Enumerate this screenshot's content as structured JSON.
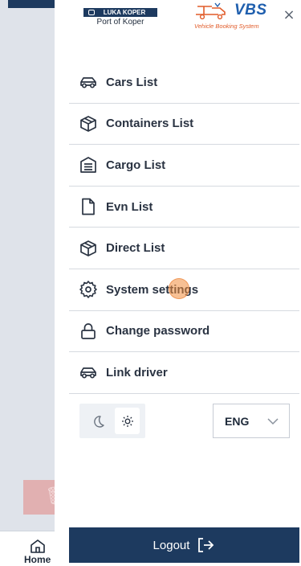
{
  "background": {
    "home_label": "Home"
  },
  "brand": {
    "port_badge": "LUKA KOPER",
    "port_sub": "Port of Koper",
    "vbs_title": "VBS",
    "vbs_sub": "Vehicle Booking System"
  },
  "close_icon": "×",
  "menu": {
    "items": [
      {
        "label": "Cars List",
        "icon": "car-icon"
      },
      {
        "label": "Containers List",
        "icon": "container-icon"
      },
      {
        "label": "Cargo List",
        "icon": "cargo-icon"
      },
      {
        "label": "Evn List",
        "icon": "document-icon"
      },
      {
        "label": "Direct List",
        "icon": "container-icon"
      },
      {
        "label": "System settings",
        "icon": "gear-icon"
      },
      {
        "label": "Change password",
        "icon": "lock-icon"
      },
      {
        "label": "Link driver",
        "icon": "car-icon"
      }
    ]
  },
  "theme": {
    "selected": "light"
  },
  "language": {
    "selected": "ENG"
  },
  "logout": {
    "label": "Logout"
  },
  "colors": {
    "primary": "#1d3a5f",
    "vbs_blue": "#1f5fae",
    "vbs_orange": "#e15b29",
    "touch": "#f08c3c"
  }
}
